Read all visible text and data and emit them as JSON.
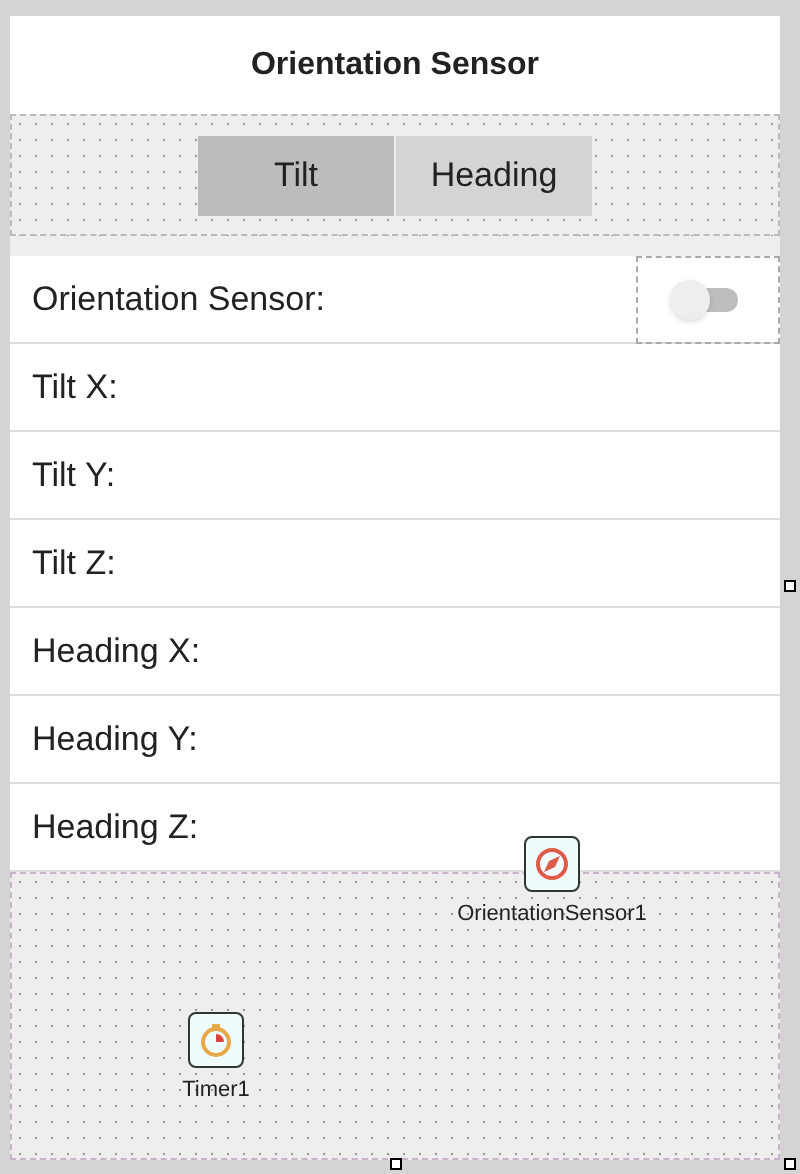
{
  "header": {
    "title": "Orientation Sensor"
  },
  "segments": [
    {
      "label": "Tilt",
      "selected": true
    },
    {
      "label": "Heading",
      "selected": false
    }
  ],
  "sensor_switch": {
    "label": "Orientation Sensor:",
    "on": false
  },
  "rows": [
    "Tilt X:",
    "Tilt Y:",
    "Tilt Z:",
    "Heading X:",
    "Heading Y:",
    "Heading Z:"
  ],
  "components": [
    {
      "name": "OrientationSensor1",
      "kind": "sensor"
    },
    {
      "name": "Timer1",
      "kind": "timer"
    }
  ]
}
